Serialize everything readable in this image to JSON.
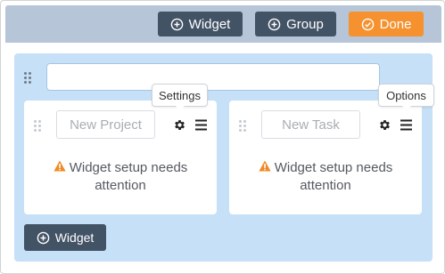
{
  "toolbar": {
    "widget_label": "Widget",
    "group_label": "Group",
    "done_label": "Done"
  },
  "group": {
    "title_value": "",
    "add_widget_label": "Widget"
  },
  "widgets": [
    {
      "name_placeholder": "New Project",
      "message_line1": "Widget setup needs",
      "message_line2": "attention",
      "tooltip": "Settings"
    },
    {
      "name_placeholder": "New Task",
      "message_line1": "Widget setup needs",
      "message_line2": "attention",
      "tooltip": "Options"
    }
  ],
  "colors": {
    "toolbar_bg": "#b6c5d7",
    "dark_button": "#435366",
    "accent_orange": "#f5922f",
    "group_bg": "#c6e0f7",
    "warning": "#f08a24"
  },
  "icons": [
    "plus-circle-icon",
    "check-circle-icon",
    "drag-handle-icon",
    "gear-icon",
    "menu-icon",
    "warning-icon"
  ]
}
